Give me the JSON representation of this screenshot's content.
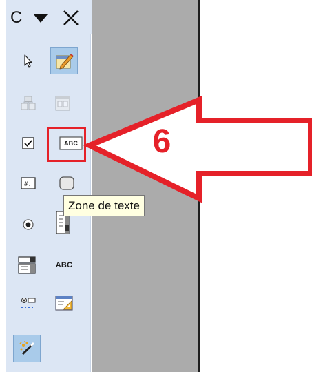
{
  "toolbar": {
    "title": "C",
    "dropdown_icon": "triangle-down-icon",
    "close_icon": "close-x-icon",
    "rows": [
      [
        "select-arrow-icon",
        "design-mode-icon"
      ],
      [
        "control-properties-icon",
        "form-properties-icon"
      ],
      [
        "checkbox-icon",
        "text-box-icon"
      ],
      [
        "formatted-field-icon",
        "push-button-icon"
      ],
      [
        "option-button-icon",
        "list-box-icon"
      ],
      [
        "combo-box-icon",
        "label-field-icon"
      ],
      [
        "more-controls-icon",
        "form-design-icon"
      ],
      [
        "wizards-icon"
      ]
    ],
    "label_field_text": "ABC",
    "text_box_text": "ABC"
  },
  "tooltip": {
    "text": "Zone de texte"
  },
  "annotation": {
    "step_number": "6",
    "color": "#e52129"
  },
  "colors": {
    "toolbar_bg": "#dce6f4",
    "pressed_bg": "#a9cbea",
    "canvas": "#ababab",
    "highlight": "#e52129"
  }
}
